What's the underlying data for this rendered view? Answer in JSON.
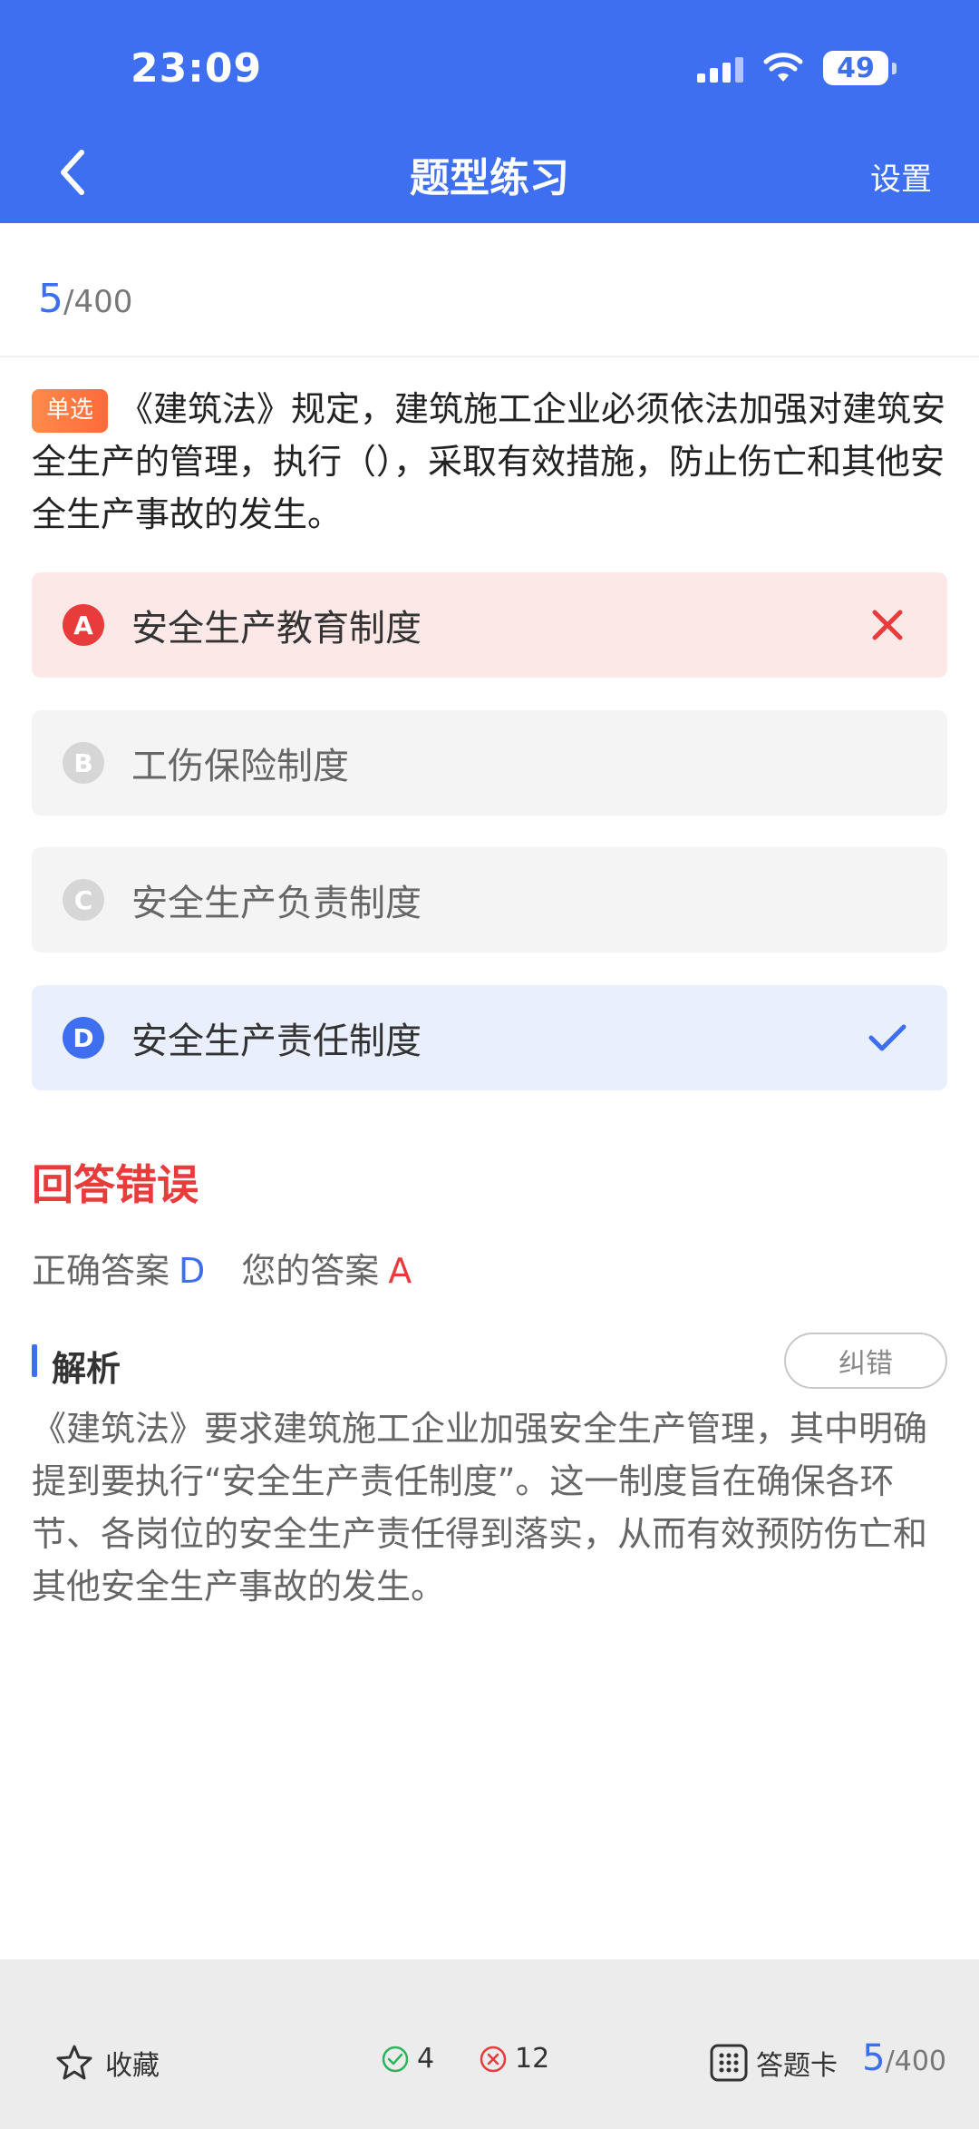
{
  "status_bar": {
    "time": "23:09",
    "battery": "49"
  },
  "nav": {
    "title": "题型练习",
    "settings_label": "设置"
  },
  "progress": {
    "current": "5",
    "total": "/400"
  },
  "question": {
    "type_label": "单选",
    "text": "《建筑法》规定，建筑施工企业必须依法加强对建筑安全生产的管理，执行（），采取有效措施，防止伤亡和其他安全生产事故的发生。"
  },
  "options": [
    {
      "letter": "A",
      "text": "安全生产教育制度",
      "state": "wrong"
    },
    {
      "letter": "B",
      "text": "工伤保险制度",
      "state": "neutral"
    },
    {
      "letter": "C",
      "text": "安全生产负责制度",
      "state": "neutral"
    },
    {
      "letter": "D",
      "text": "安全生产责任制度",
      "state": "correct"
    }
  ],
  "result": {
    "title": "回答错误",
    "correct_label": "正确答案",
    "correct_value": "D",
    "your_label": "您的答案",
    "your_value": "A"
  },
  "analysis": {
    "title": "解析",
    "report_label": "纠错",
    "body": "《建筑法》要求建筑施工企业加强安全生产管理，其中明确提到要执行“安全生产责任制度”。这一制度旨在确保各环节、各岗位的安全生产责任得到落实，从而有效预防伤亡和其他安全生产事故的发生。"
  },
  "bottom_bar": {
    "favorite_label": "收藏",
    "correct_count": "4",
    "wrong_count": "12",
    "answer_card_label": "答题卡",
    "progress_current": "5",
    "progress_total": "/400"
  },
  "colors": {
    "brand_blue": "#3d6ff0",
    "error_red": "#e83b3b",
    "correct_green": "#2db55d"
  }
}
